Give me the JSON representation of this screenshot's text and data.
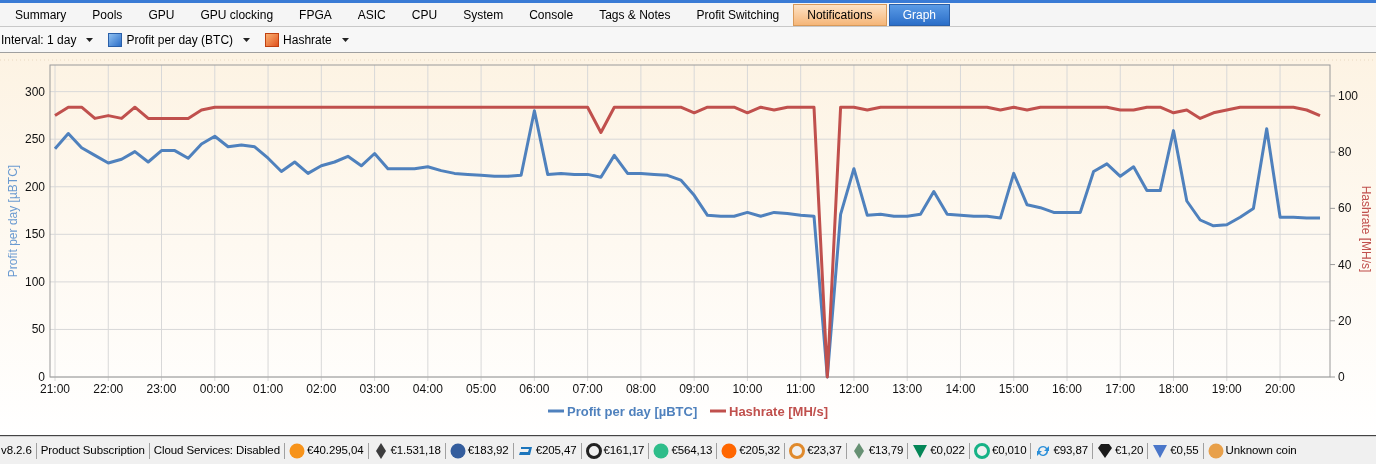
{
  "tabs": [
    {
      "label": "Summary",
      "selected": false,
      "highlighted": false
    },
    {
      "label": "Pools",
      "selected": false,
      "highlighted": false
    },
    {
      "label": "GPU",
      "selected": false,
      "highlighted": false
    },
    {
      "label": "GPU clocking",
      "selected": false,
      "highlighted": false
    },
    {
      "label": "FPGA",
      "selected": false,
      "highlighted": false
    },
    {
      "label": "ASIC",
      "selected": false,
      "highlighted": false
    },
    {
      "label": "CPU",
      "selected": false,
      "highlighted": false
    },
    {
      "label": "System",
      "selected": false,
      "highlighted": false
    },
    {
      "label": "Console",
      "selected": false,
      "highlighted": false
    },
    {
      "label": "Tags & Notes",
      "selected": false,
      "highlighted": false
    },
    {
      "label": "Profit Switching",
      "selected": false,
      "highlighted": false
    },
    {
      "label": "Notifications",
      "selected": false,
      "highlighted": true
    },
    {
      "label": "Graph",
      "selected": true,
      "highlighted": false
    }
  ],
  "toolbar": [
    {
      "label": "Interval: 1 day",
      "kind": "plain"
    },
    {
      "label": "Profit per day (BTC)",
      "kind": "profit"
    },
    {
      "label": "Hashrate",
      "kind": "hashrate"
    }
  ],
  "chart": {
    "chart_data": {
      "type": "line",
      "ylabel": "Profit per day [µBTC]",
      "y2label": "Hashrate [MH/s]",
      "ylim": [
        0,
        328
      ],
      "y2lim": [
        0,
        111
      ],
      "grid": true,
      "legend": true,
      "categories": [
        "21:00",
        null,
        null,
        null,
        "22:00",
        null,
        null,
        null,
        "23:00",
        null,
        null,
        null,
        "00:00",
        null,
        null,
        null,
        "01:00",
        null,
        null,
        null,
        "02:00",
        null,
        null,
        null,
        "03:00",
        null,
        null,
        null,
        "04:00",
        null,
        null,
        null,
        "05:00",
        null,
        null,
        null,
        "06:00",
        null,
        null,
        null,
        "07:00",
        null,
        null,
        null,
        "08:00",
        null,
        null,
        null,
        "09:00",
        null,
        null,
        null,
        "10:00",
        null,
        null,
        null,
        "11:00",
        null,
        null,
        null,
        "12:00",
        null,
        null,
        null,
        "13:00",
        null,
        null,
        null,
        "14:00",
        null,
        null,
        null,
        "15:00",
        null,
        null,
        null,
        "16:00",
        null,
        null,
        null,
        "17:00",
        null,
        null,
        null,
        "18:00",
        null,
        null,
        null,
        "19:00",
        null,
        null,
        null,
        "20:00",
        null,
        null,
        null
      ],
      "yticks": [
        0,
        50,
        100,
        150,
        200,
        250,
        300
      ],
      "y2ticks": [
        0,
        20,
        40,
        60,
        80,
        100
      ],
      "series": [
        {
          "name": "Profit per day [µBTC]",
          "color": "#4f81bd",
          "values": [
            240,
            256,
            241,
            233,
            225,
            229,
            237,
            226,
            238,
            238,
            230,
            245,
            253,
            242,
            244,
            242,
            230,
            216,
            226,
            214,
            222,
            226,
            232,
            222,
            235,
            219,
            219,
            219,
            221,
            217,
            214,
            213,
            212,
            211,
            211,
            212,
            280,
            213,
            214,
            213,
            213,
            210,
            233,
            214,
            214,
            213,
            212,
            207,
            191,
            170,
            169,
            169,
            173,
            169,
            173,
            172,
            170,
            169,
            0,
            171,
            219,
            170,
            171,
            169,
            169,
            171,
            195,
            171,
            170,
            169,
            169,
            167,
            214,
            181,
            178,
            173,
            173,
            173,
            216,
            224,
            211,
            221,
            196,
            196,
            259,
            185,
            165,
            159,
            160,
            168,
            177,
            261,
            168,
            168,
            167,
            167
          ]
        },
        {
          "name": "Hashrate [MH/s]",
          "color": "#c0504d",
          "axis": "y2",
          "values": [
            93,
            96,
            96,
            92,
            93,
            92,
            96,
            92,
            92,
            92,
            92,
            95,
            96,
            96,
            96,
            96,
            96,
            96,
            96,
            96,
            96,
            96,
            96,
            96,
            96,
            96,
            96,
            96,
            96,
            96,
            96,
            96,
            96,
            96,
            96,
            96,
            96,
            96,
            96,
            96,
            96,
            87,
            96,
            96,
            96,
            96,
            96,
            96,
            94,
            96,
            96,
            96,
            94,
            96,
            95,
            96,
            96,
            96,
            0,
            96,
            96,
            95,
            96,
            96,
            96,
            96,
            96,
            96,
            96,
            96,
            96,
            95,
            96,
            95,
            96,
            96,
            96,
            96,
            96,
            96,
            95,
            95,
            96,
            96,
            94,
            95,
            92,
            94,
            95,
            96,
            96,
            96,
            96,
            96,
            95,
            93
          ]
        }
      ]
    }
  },
  "status_bar": {
    "items": [
      "v8.2.6",
      "Product Subscription",
      "Cloud Services: Disabled"
    ],
    "coins": [
      {
        "kind": "circle",
        "color": "#f7931a",
        "price": "€40.295,04"
      },
      {
        "kind": "diamond",
        "color": "#3c3c3d",
        "price": "€1.531,18"
      },
      {
        "kind": "circle",
        "color": "#345d9d",
        "price": "€183,92"
      },
      {
        "kind": "dash",
        "color": "#1c75bc",
        "price": "€205,47"
      },
      {
        "kind": "ring",
        "color": "#222222",
        "price": "€161,17"
      },
      {
        "kind": "circle",
        "color": "#2ebd8a",
        "price": "€564,13"
      },
      {
        "kind": "circle",
        "color": "#ff6600",
        "price": "€205,32"
      },
      {
        "kind": "ring",
        "color": "#e08a2c",
        "price": "€23,37"
      },
      {
        "kind": "diamond",
        "color": "#669073",
        "price": "€13,79"
      },
      {
        "kind": "triangle",
        "color": "#048657",
        "price": "€0,022"
      },
      {
        "kind": "ring",
        "color": "#16b286",
        "price": "€0,010"
      },
      {
        "kind": "arrows",
        "color": "#2a8fd9",
        "price": "€93,87"
      },
      {
        "kind": "gem",
        "color": "#1a1a1a",
        "price": "€1,20"
      },
      {
        "kind": "triangle",
        "color": "#4a76c9",
        "price": "€0,55"
      },
      {
        "kind": "circle",
        "color": "#e8a04a",
        "price": "Unknown coin"
      }
    ]
  }
}
